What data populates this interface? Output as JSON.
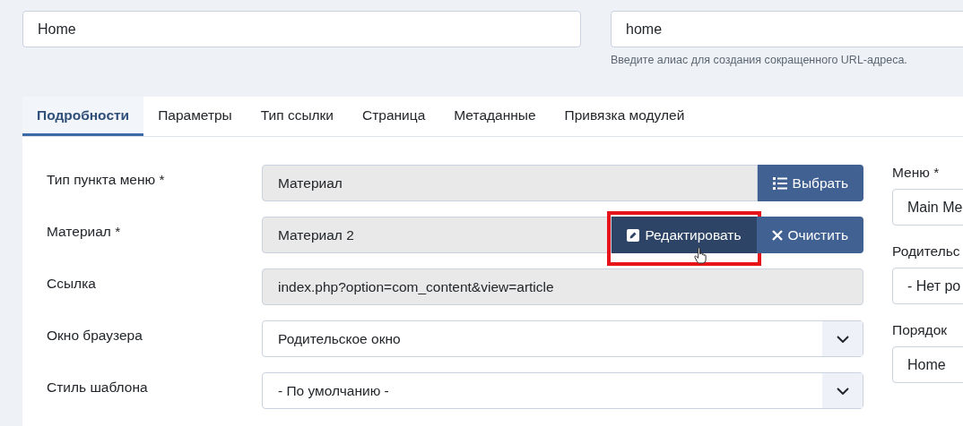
{
  "title_field": {
    "value": "Home"
  },
  "alias_field": {
    "value": "home",
    "hint": "Введите алиас для создания сокращенного URL-адреса."
  },
  "tabs": [
    {
      "label": "Подробности",
      "selected": true
    },
    {
      "label": "Параметры",
      "selected": false
    },
    {
      "label": "Тип ссылки",
      "selected": false
    },
    {
      "label": "Страница",
      "selected": false
    },
    {
      "label": "Метаданные",
      "selected": false
    },
    {
      "label": "Привязка модулей",
      "selected": false
    }
  ],
  "fields": [
    {
      "label": "Тип пункта меню *",
      "kind": "readonly",
      "value": "Материал",
      "buttons": [
        {
          "label": "Выбрать",
          "kind": "list",
          "hovered": false,
          "highlighted": false
        }
      ]
    },
    {
      "label": "Материал *",
      "kind": "readonly",
      "value": "Материал 2",
      "buttons": [
        {
          "label": "Редактировать",
          "kind": "edit",
          "hovered": true,
          "highlighted": true
        },
        {
          "label": "Очистить",
          "kind": "close",
          "hovered": false,
          "highlighted": false
        }
      ]
    },
    {
      "label": "Ссылка",
      "kind": "readonly",
      "value": "index.php?option=com_content&view=article"
    },
    {
      "label": "Окно браузера",
      "kind": "select",
      "value": "Родительское окно"
    },
    {
      "label": "Стиль шаблона",
      "kind": "select",
      "value": "- По умолчанию -"
    }
  ],
  "side_fields": [
    {
      "label": "Меню *",
      "value": "Main Me"
    },
    {
      "label": "Родительс",
      "value": "- Нет ро"
    },
    {
      "label": "Порядок",
      "value": "Home"
    }
  ]
}
